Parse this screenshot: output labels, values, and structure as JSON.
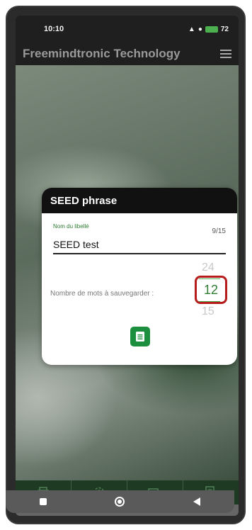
{
  "status_bar": {
    "time": "10:10",
    "indicators": "72"
  },
  "app_bar": {
    "title": "Freemindtronic Technology",
    "menu_icon": "hamburger-menu-icon"
  },
  "dialog": {
    "title": "SEED phrase",
    "field": {
      "label": "Nom du libellé",
      "value": "SEED test",
      "counter": "9/15"
    },
    "words_label": "Nombre de mots à sauvegarder :",
    "picker": {
      "above": "24",
      "selected": "12",
      "below": "15"
    },
    "save_icon": "list-document-icon"
  },
  "bottom_bar": {
    "items": [
      {
        "icon": "printer-icon"
      },
      {
        "icon": "settings-gear-icon"
      },
      {
        "icon": "devices-icon"
      },
      {
        "icon": "document-search-icon"
      }
    ]
  },
  "system_nav": {
    "items": [
      "recent-apps-icon",
      "home-icon",
      "back-icon"
    ]
  },
  "colors": {
    "accent_green": "#1b8f3e",
    "highlight_red": "#b71c1c",
    "header_black": "#111111"
  }
}
